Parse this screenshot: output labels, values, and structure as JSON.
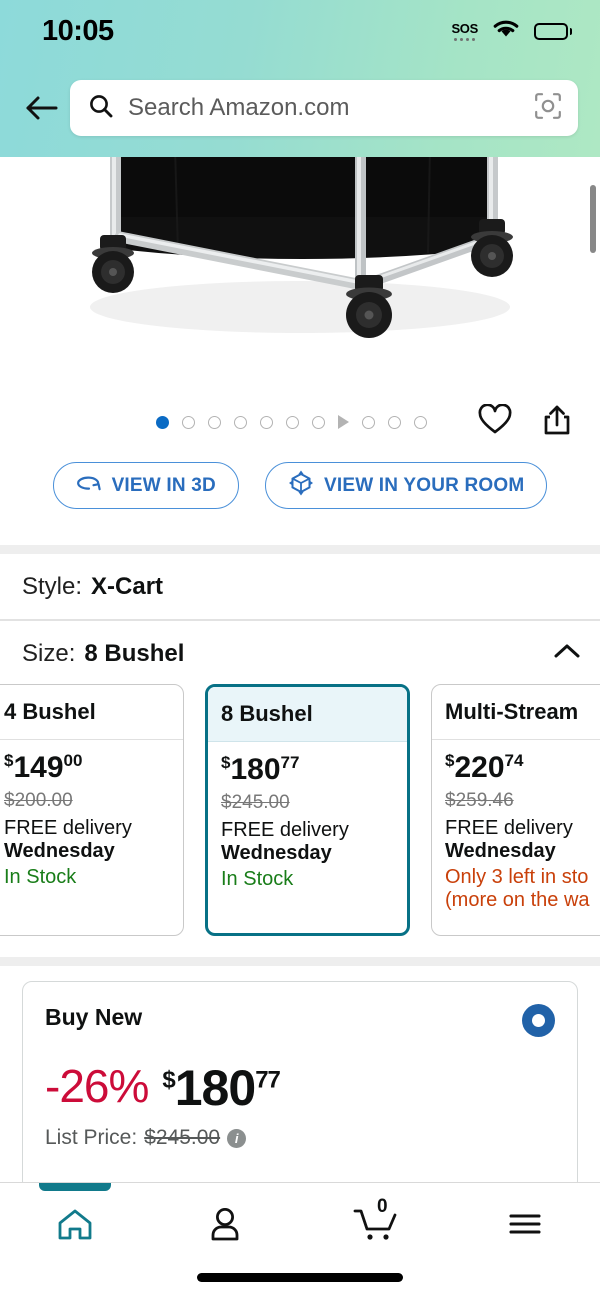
{
  "status_bar": {
    "time": "10:05",
    "sos_label": "SOS",
    "wifi_icon": "wifi-icon",
    "battery_icon": "battery-full-icon"
  },
  "header": {
    "back_icon": "back-arrow-icon",
    "search_icon": "search-icon",
    "search_placeholder": "Search Amazon.com",
    "search_value": "",
    "camera_icon": "camera-scan-icon",
    "gradient_from": "#8ddada",
    "gradient_to": "#aee8c4"
  },
  "gallery": {
    "product_alt": "Black canvas laundry X-cart on chrome frame with casters",
    "dots": [
      {
        "type": "dot",
        "active": true
      },
      {
        "type": "dot",
        "active": false
      },
      {
        "type": "dot",
        "active": false
      },
      {
        "type": "dot",
        "active": false
      },
      {
        "type": "dot",
        "active": false
      },
      {
        "type": "dot",
        "active": false
      },
      {
        "type": "dot",
        "active": false
      },
      {
        "type": "play",
        "active": false
      },
      {
        "type": "dot",
        "active": false
      },
      {
        "type": "dot",
        "active": false
      },
      {
        "type": "dot",
        "active": false
      }
    ],
    "active_index": 0,
    "wishlist_icon": "heart-outline-icon",
    "share_icon": "share-icon",
    "view_3d_label": "VIEW IN 3D",
    "view_3d_icon": "rotate-3d-icon",
    "view_room_label": "VIEW IN YOUR ROOM",
    "view_room_icon": "ar-cube-icon",
    "accent_blue": "#2a6dbd"
  },
  "attributes": {
    "style": {
      "label": "Style:",
      "value": "X-Cart"
    },
    "size": {
      "label": "Size:",
      "value": "8 Bushel",
      "collapse_icon": "chevron-up-icon"
    }
  },
  "size_options": [
    {
      "title": "4 Bushel",
      "price_currency": "$",
      "price_whole": "149",
      "price_cents": "00",
      "list_price": "$200.00",
      "delivery_line": "FREE delivery",
      "delivery_day": "Wednesday",
      "stock": "In Stock",
      "stock_state": "ok",
      "selected": false
    },
    {
      "title": "8 Bushel",
      "price_currency": "$",
      "price_whole": "180",
      "price_cents": "77",
      "list_price": "$245.00",
      "delivery_line": "FREE delivery",
      "delivery_day": "Wednesday",
      "stock": "In Stock",
      "stock_state": "ok",
      "selected": true
    },
    {
      "title": "Multi-Stream",
      "price_currency": "$",
      "price_whole": "220",
      "price_cents": "74",
      "list_price": "$259.46",
      "delivery_line": "FREE delivery",
      "delivery_day": "Wednesday",
      "stock": "Only 3 left in sto",
      "stock_extra": "(more on the wa",
      "stock_state": "low",
      "selected": false
    }
  ],
  "buy_new": {
    "title": "Buy New",
    "selected": true,
    "discount": "-26%",
    "price_currency": "$",
    "price_whole": "180",
    "price_cents": "77",
    "list_price_label": "List Price:",
    "list_price_value": "$245.00",
    "info_icon": "info-icon",
    "discount_color": "#cc0c39",
    "radio_color": "#2162a8"
  },
  "bottom_nav": {
    "active": "home",
    "items": [
      {
        "name": "home",
        "icon": "home-icon",
        "active": true
      },
      {
        "name": "account",
        "icon": "person-icon",
        "active": false
      },
      {
        "name": "cart",
        "icon": "cart-icon",
        "badge": "0",
        "active": false
      },
      {
        "name": "menu",
        "icon": "hamburger-menu-icon",
        "active": false
      }
    ],
    "active_color": "#117a8b"
  }
}
